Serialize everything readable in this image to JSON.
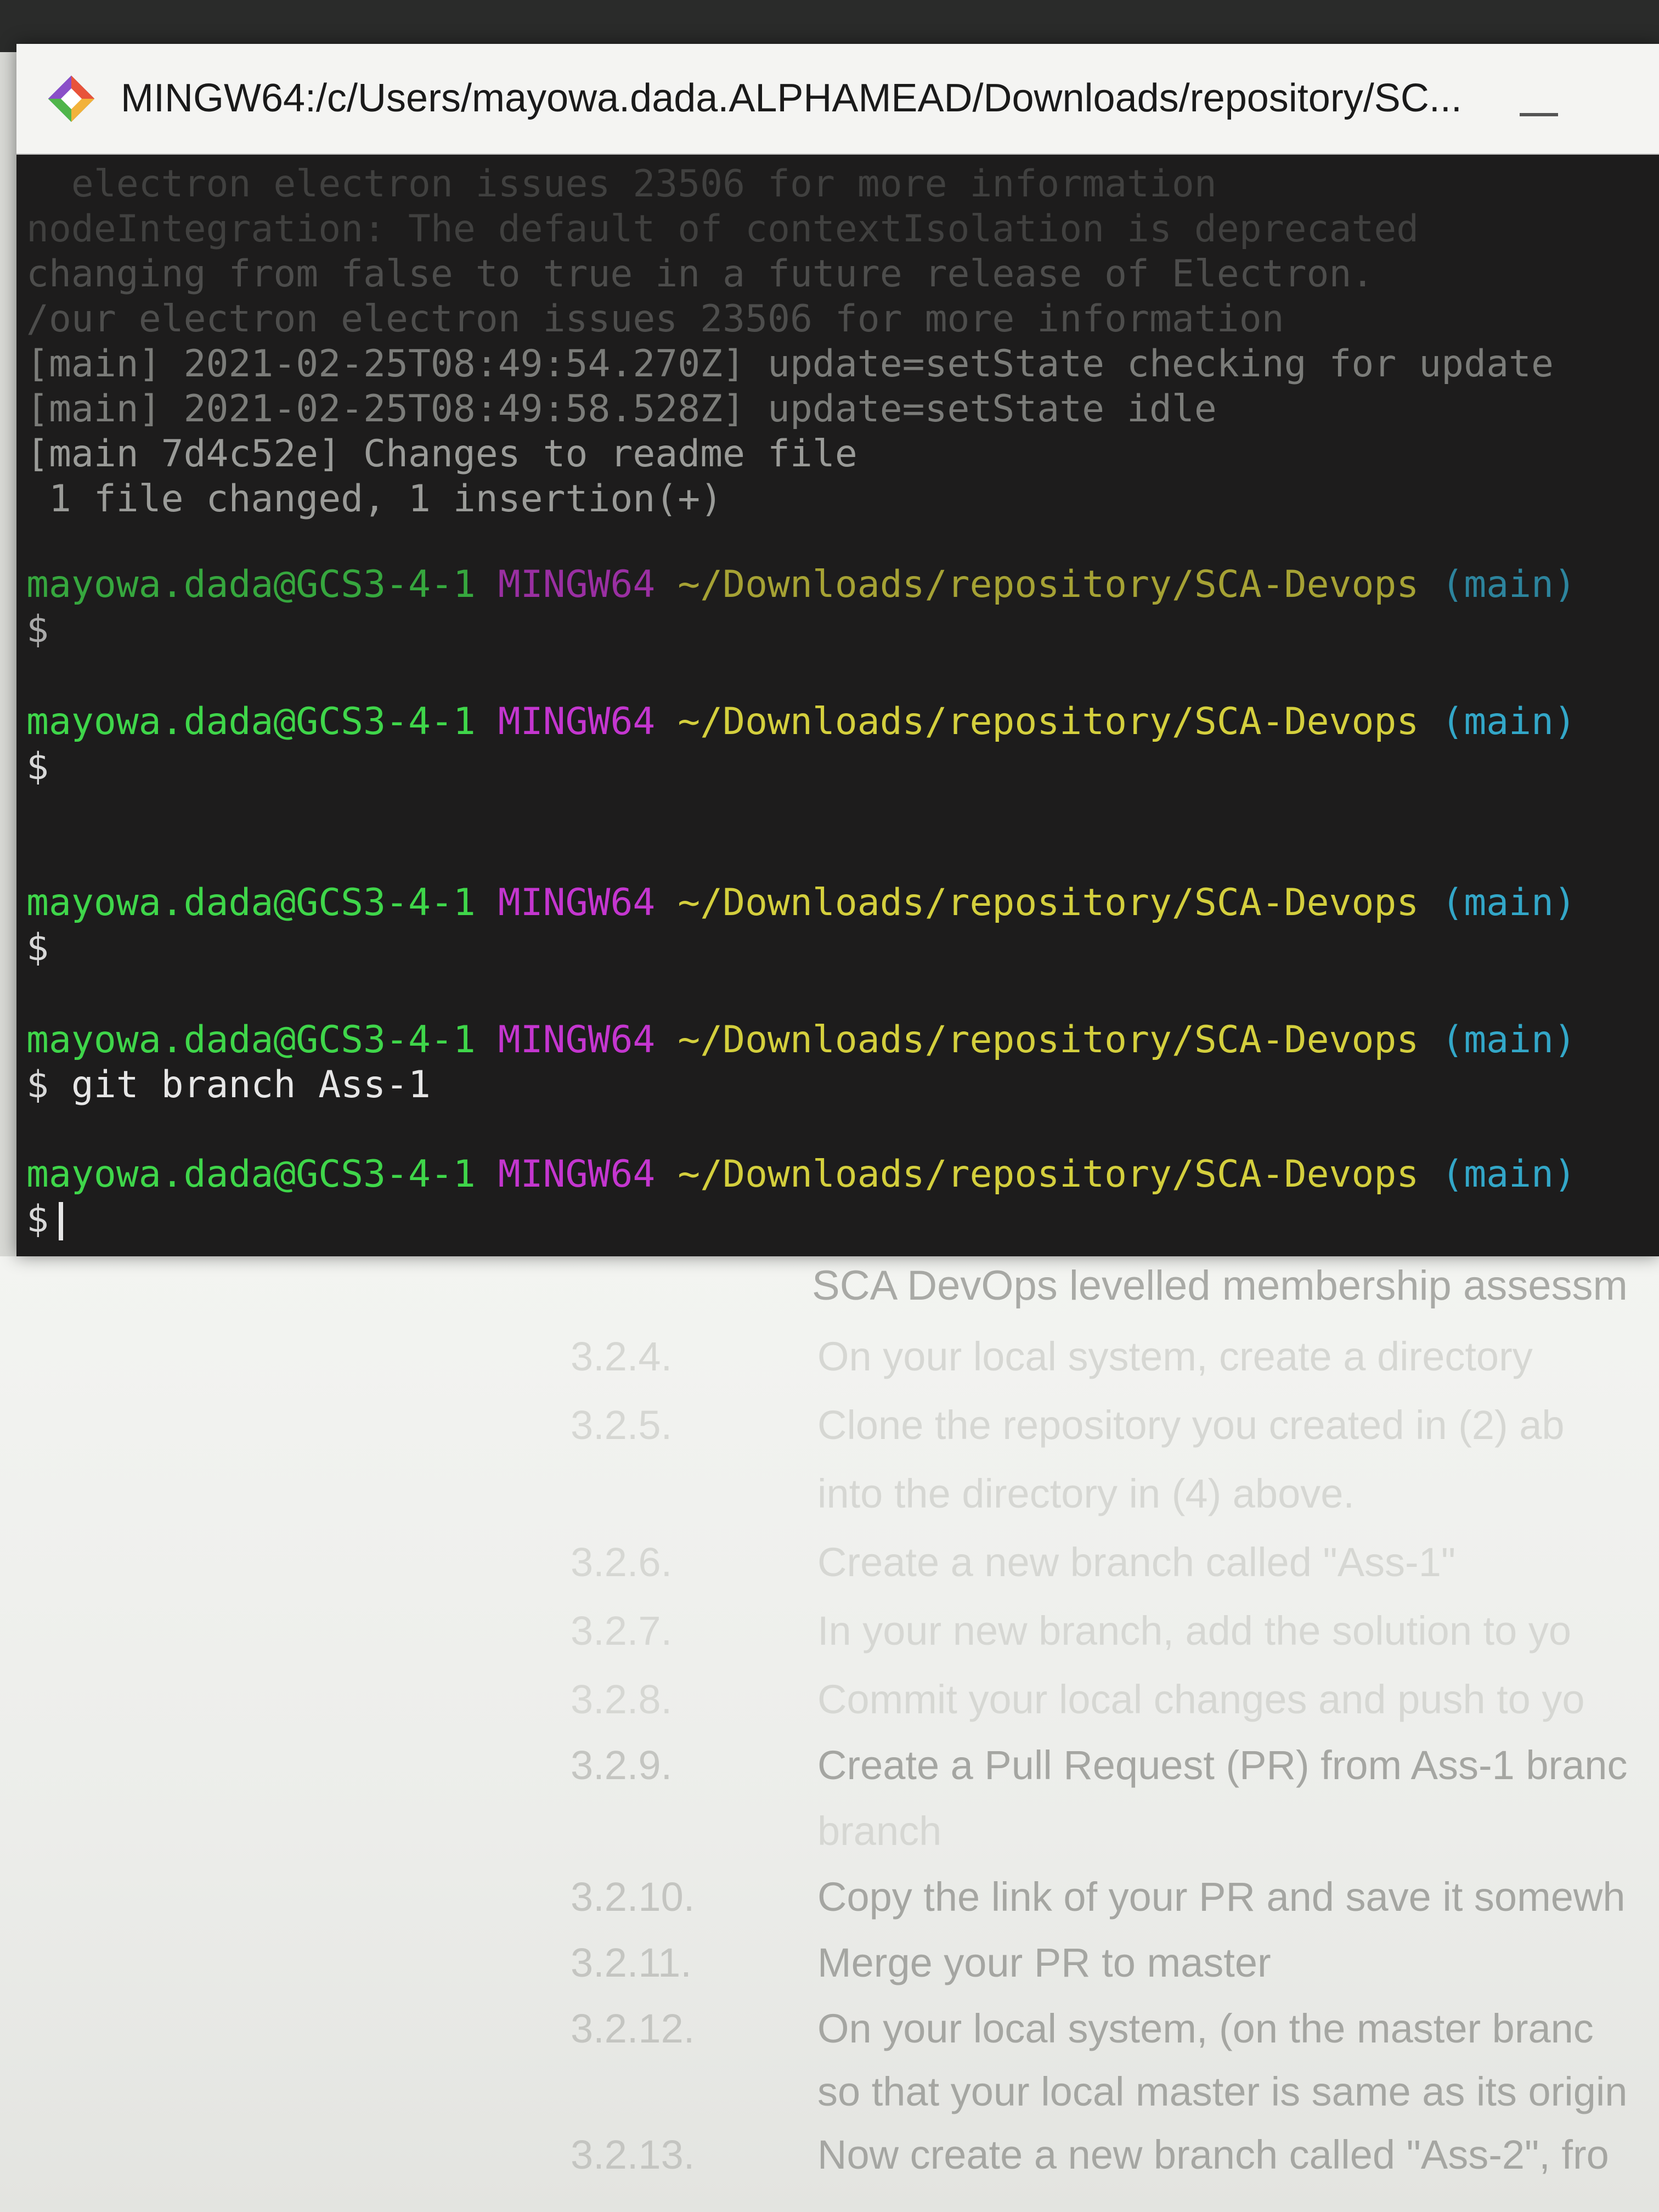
{
  "window": {
    "title": "MINGW64:/c/Users/mayowa.dada.ALPHAMEAD/Downloads/repository/SC..."
  },
  "terminal": {
    "log_lines": [
      "[main] 2021-02-25T08:49:54.270Z] update=setState checking for update",
      "[main] 2021-02-25T08:49:58.528Z] update=setState idle",
      "[main 7d4c52e] Changes to readme file",
      " 1 file changed, 1 insertion(+)"
    ],
    "prompts": [
      {
        "user": "mayowa.dada@GCS3-4-1",
        "host": "MINGW64",
        "path": "~/Downloads/repository/SCA-Devops",
        "branch": "(main)",
        "symbol": "$",
        "command": ""
      },
      {
        "user": "mayowa.dada@GCS3-4-1",
        "host": "MINGW64",
        "path": "~/Downloads/repository/SCA-Devops",
        "branch": "(main)",
        "symbol": "$",
        "command": ""
      },
      {
        "user": "mayowa.dada@GCS3-4-1",
        "host": "MINGW64",
        "path": "~/Downloads/repository/SCA-Devops",
        "branch": "(main)",
        "symbol": "$",
        "command": ""
      },
      {
        "user": "mayowa.dada@GCS3-4-1",
        "host": "MINGW64",
        "path": "~/Downloads/repository/SCA-Devops",
        "branch": "(main)",
        "symbol": "$",
        "command": "git branch Ass-1"
      },
      {
        "user": "mayowa.dada@GCS3-4-1",
        "host": "MINGW64",
        "path": "~/Downloads/repository/SCA-Devops",
        "branch": "(main)",
        "symbol": "$",
        "command": ""
      }
    ]
  },
  "document": {
    "heading": "SCA DevOps levelled membership assessm",
    "items": [
      {
        "num": "3.2.4.",
        "text": "On your local system, create a directory"
      },
      {
        "num": "3.2.5.",
        "text": "Clone the repository you created in (2) ab"
      },
      {
        "num": "",
        "text": "into the directory in (4) above."
      },
      {
        "num": "3.2.6.",
        "text": "Create a new branch called \"Ass-1\""
      },
      {
        "num": "3.2.7.",
        "text": "In your new branch, add the solution to yo"
      },
      {
        "num": "3.2.8.",
        "text": "Commit your local changes and push to yo"
      },
      {
        "num": "3.2.9.",
        "text": "Create a Pull Request (PR) from Ass-1 branc"
      },
      {
        "num": "",
        "text": "branch"
      },
      {
        "num": "3.2.10.",
        "text": "Copy the link of your PR and save it somewh"
      },
      {
        "num": "3.2.11.",
        "text": "Merge your PR to master"
      },
      {
        "num": "3.2.12.",
        "text": "On your local system, (on the master branc"
      },
      {
        "num": "",
        "text": "so that your local master is same as its origin"
      },
      {
        "num": "3.2.13.",
        "text": "Now create a new branch called \"Ass-2\", fro"
      }
    ]
  },
  "colors": {
    "terminal_bg": "#1d1c1c",
    "user": "#3fd64a",
    "host": "#c436cf",
    "path": "#d4cf3d",
    "branch": "#33a7c8"
  }
}
